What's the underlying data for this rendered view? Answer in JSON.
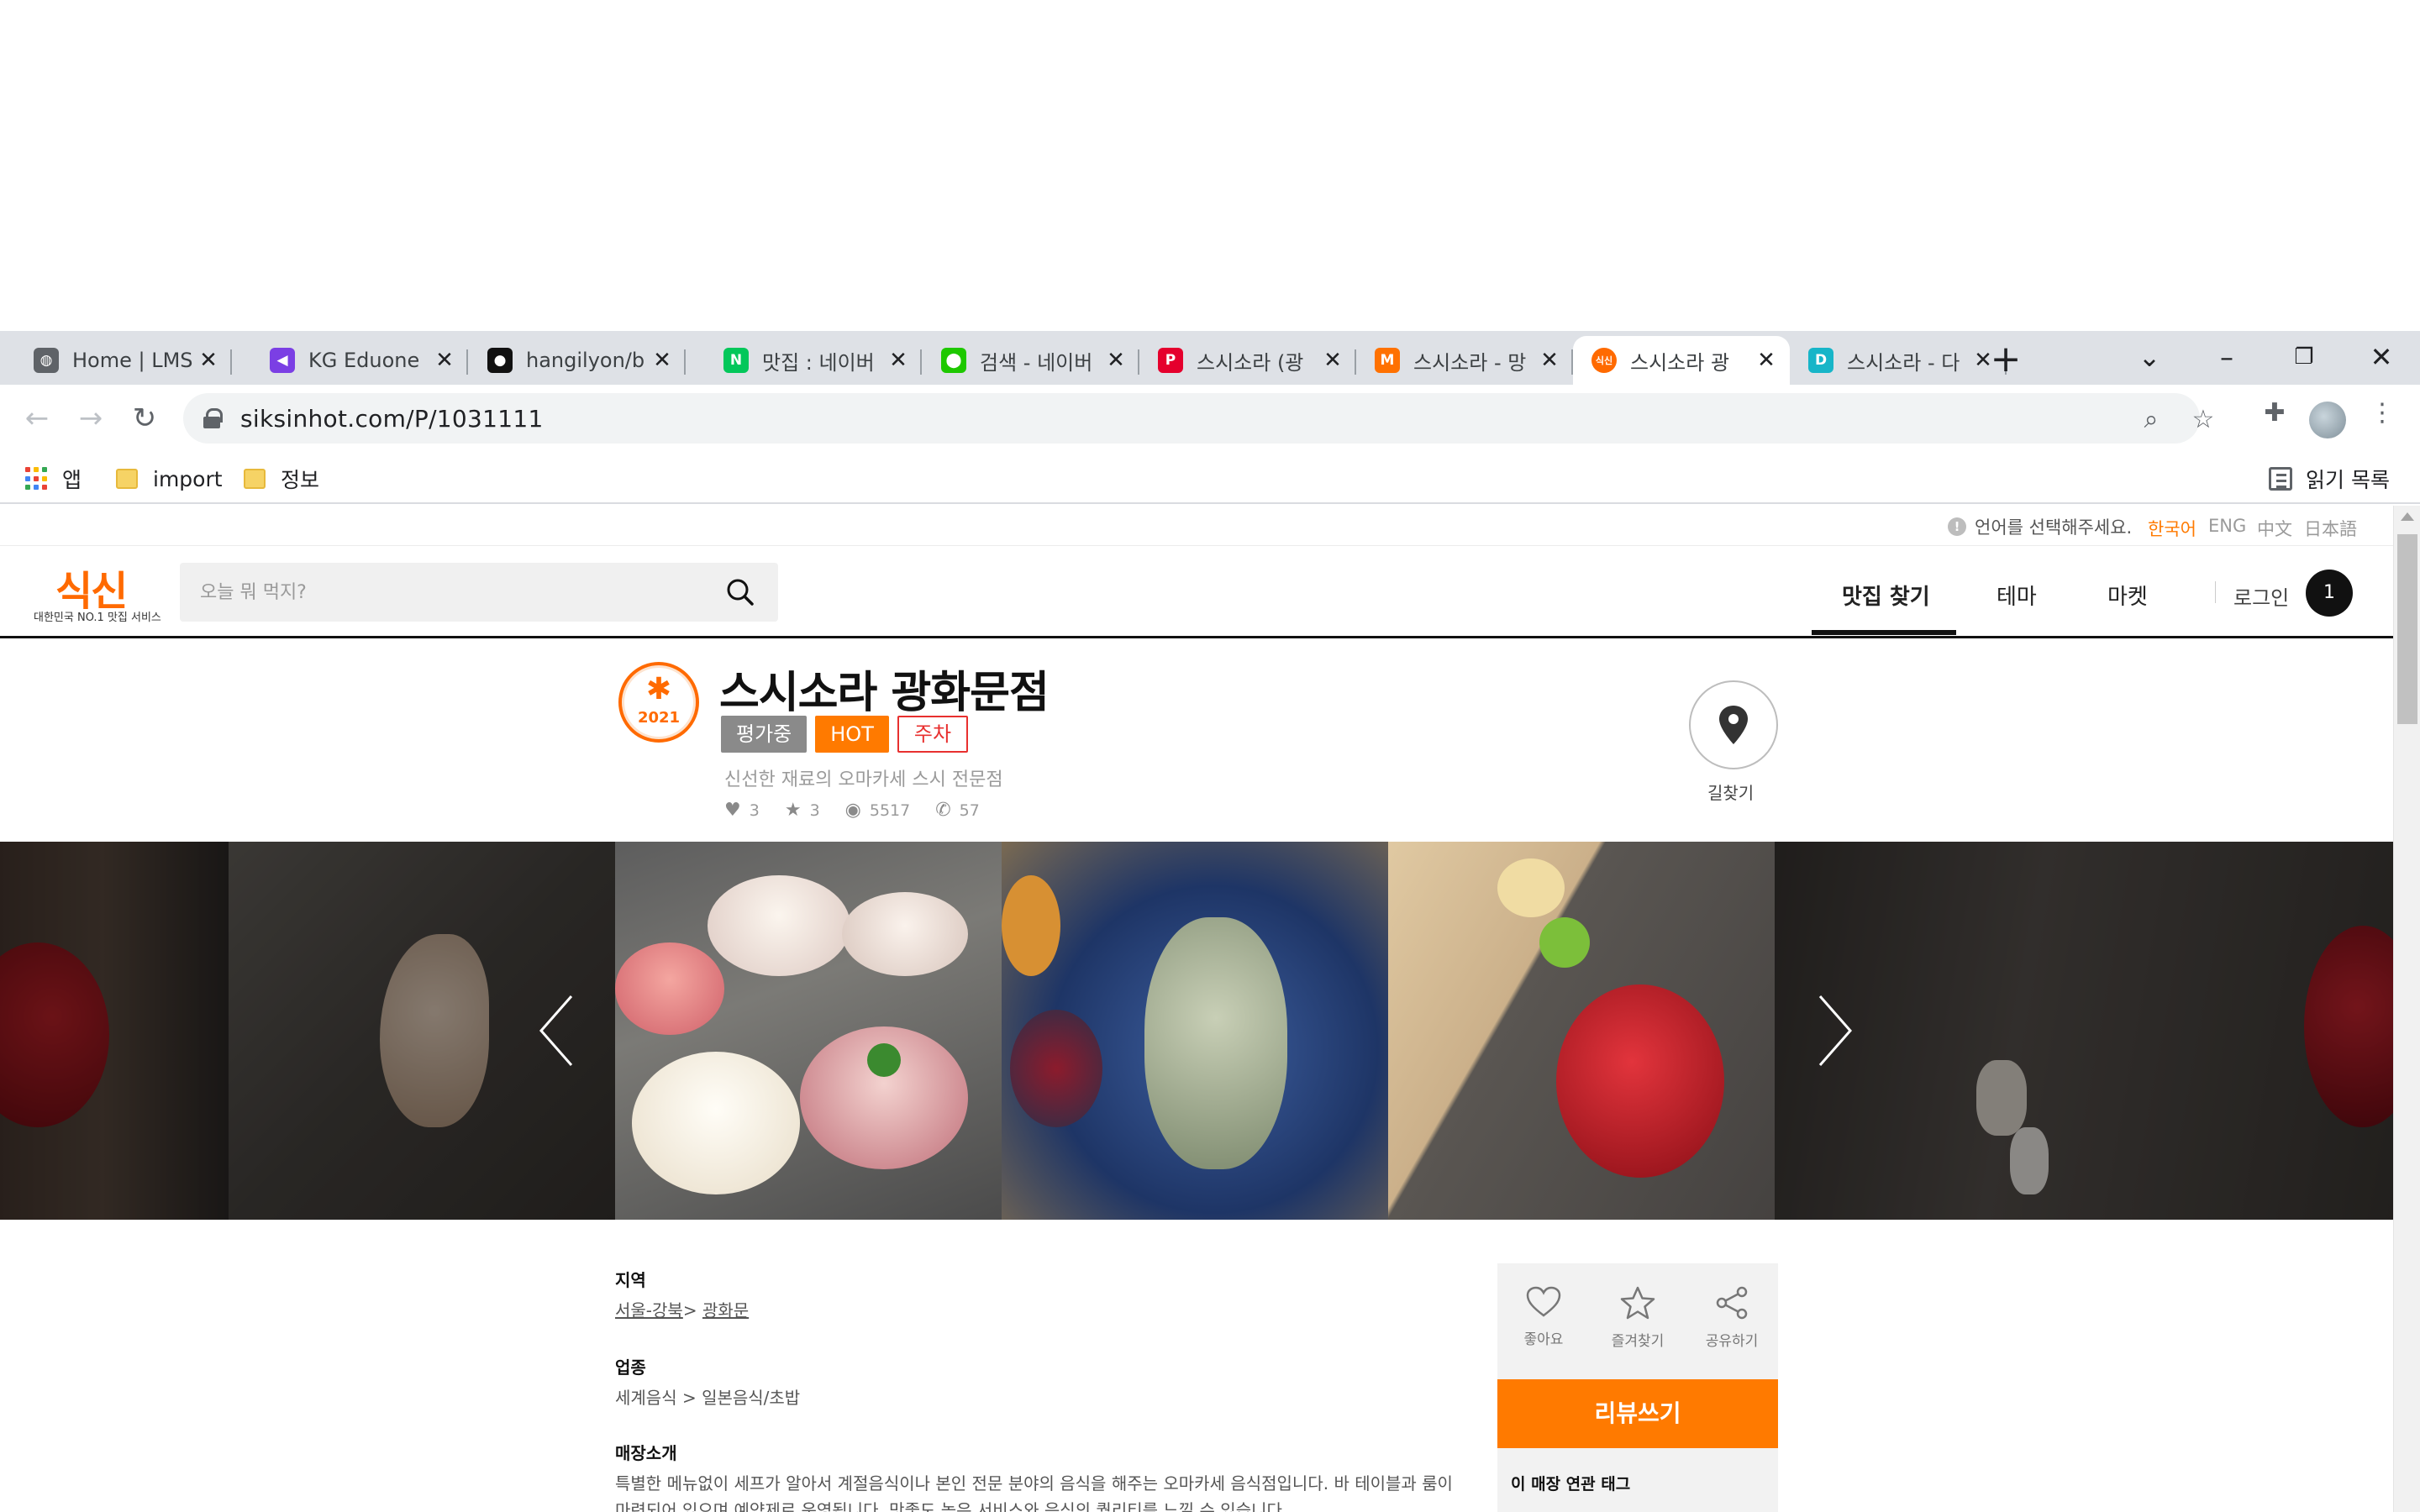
{
  "browser": {
    "tabs": [
      {
        "title": "Home | LMS",
        "favicon": "globe-icon",
        "fav_color": "#5f6368",
        "fav_text": "◍"
      },
      {
        "title": "KG Eduone",
        "favicon": "kg-eduone-icon",
        "fav_color": "#7b3fe4",
        "fav_text": "◀"
      },
      {
        "title": "hangilyon/b",
        "favicon": "github-icon",
        "fav_color": "#111111",
        "fav_text": "●"
      },
      {
        "title": "맛집 : 네이버",
        "favicon": "naver-icon",
        "fav_color": "#03c75a",
        "fav_text": "N"
      },
      {
        "title": "검색 - 네이버",
        "favicon": "naver-map-icon",
        "fav_color": "#1ec800",
        "fav_text": "⬤"
      },
      {
        "title": "스시소라 (광",
        "favicon": "p-icon",
        "fav_color": "#e5002d",
        "fav_text": "P"
      },
      {
        "title": "스시소라 - 망",
        "favicon": "mangoplate-icon",
        "fav_color": "#ff7100",
        "fav_text": "M"
      },
      {
        "title": "스시소라 광",
        "favicon": "siksin-icon",
        "fav_color": "#ff6a00",
        "fav_text": "식신",
        "active": true
      },
      {
        "title": "스시소라 - 다",
        "favicon": "diningcode-icon",
        "fav_color": "#17b5c8",
        "fav_text": "D"
      }
    ],
    "close_glyph": "✕",
    "new_tab_glyph": "+",
    "url": "siksinhot.com/P/1031111",
    "bookmarks": {
      "apps_label": "앱",
      "folders": [
        "import",
        "정보"
      ],
      "reading_list": "읽기 목록"
    }
  },
  "site": {
    "lang_prompt": "언어를 선택해주세요.",
    "languages": [
      "한국어",
      "ENG",
      "中文",
      "日本語"
    ],
    "logo": "식신",
    "logo_sub": "대한민국 NO.1 맛집 서비스",
    "search_placeholder": "오늘 뭐 먹지?",
    "nav": [
      "맛집 찾기",
      "테마",
      "마켓"
    ],
    "login": "로그인",
    "cart_count": "1"
  },
  "place": {
    "badge_year": "2021",
    "title": "스시소라 광화문점",
    "tags": [
      "평가중",
      "HOT",
      "주차"
    ],
    "description": "신선한 재료의 오마카세 스시 전문점",
    "stats": {
      "likes": "3",
      "favorites": "3",
      "views": "5517",
      "calls": "57"
    },
    "route_label": "길찾기"
  },
  "info": {
    "region_label": "지역",
    "region_parts": [
      "서울-강북",
      "광화문"
    ],
    "category_label": "업종",
    "category_value": "세계음식 > 일본음식/초밥",
    "intro_label": "매장소개",
    "intro_line1": "특별한 메뉴없이 세프가 알아서 계절음식이나 본인 전문 분야의 음식을 해주는 오마카세 음식점입니다. 바 테이블과 룸이",
    "intro_line2": "마련되어 있으며 예약제로 운영됩니다. 맛좋도 높은 서비스와 음식의 퀄리티를 느낄 수 있습니다."
  },
  "sidebar": {
    "like": "좋아요",
    "favorite": "즐겨찾기",
    "share": "공유하기",
    "review_button": "리뷰쓰기",
    "tags_heading": "이 매장 연관 태그"
  },
  "colors": {
    "brand_orange": "#ff7a00",
    "parking_red": "#e8302f"
  }
}
